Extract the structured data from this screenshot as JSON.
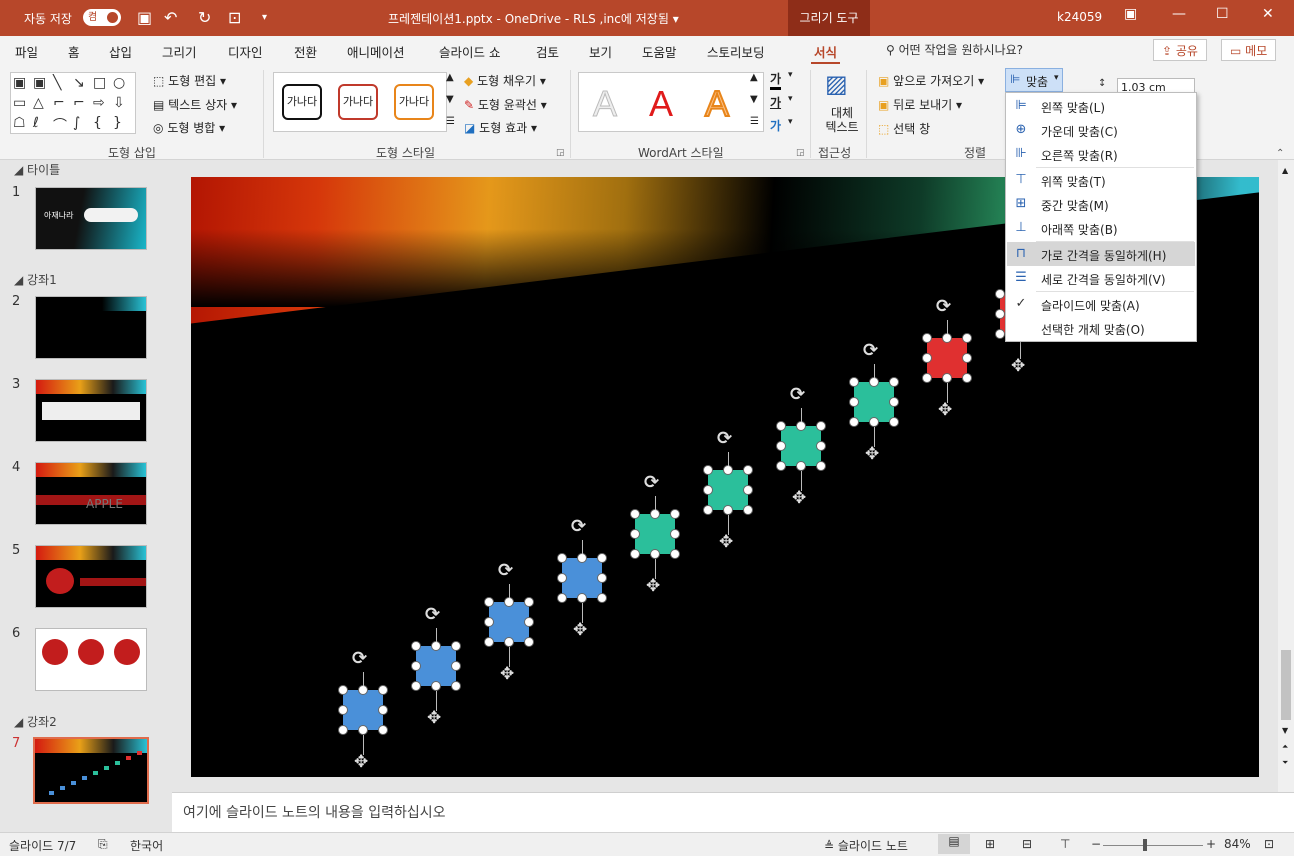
{
  "titlebar": {
    "autosave": "자동 저장",
    "toggle": "켬",
    "doc_title": "프레젠테이션1.pptx - OneDrive - RLS ,inc에 저장됨",
    "doc_caret": "▾",
    "context_tab": "그리기 도구",
    "user": "k24059",
    "ribbon_opts_icon": "▣",
    "minimize": "—",
    "maximize": "☐",
    "close": "✕"
  },
  "menu": {
    "tabs": [
      "파일",
      "홈",
      "삽입",
      "그리기",
      "디자인",
      "전환",
      "애니메이션",
      "슬라이드 쇼",
      "검토",
      "보기",
      "도움말",
      "스토리보딩",
      "서식"
    ],
    "tell_me": "어떤 작업을 원하시나요?",
    "share": "공유",
    "comments": "메모"
  },
  "ribbon": {
    "insert_shapes": {
      "label": "도형 삽입",
      "edit_shape": "도형 편집",
      "text_box": "텍스트 상자",
      "merge_shapes": "도형 병합"
    },
    "shape_styles": {
      "label": "도형 스타일",
      "sample": "가나다",
      "fill": "도형 채우기",
      "outline": "도형 윤곽선",
      "effects": "도형 효과"
    },
    "wordart": {
      "label": "WordArt 스타일",
      "letter": "A",
      "text_fill": "가",
      "text_outline": "가",
      "text_effects": "가"
    },
    "accessibility": {
      "label": "접근성",
      "alt_text": "대체 텍스트"
    },
    "arrange": {
      "label": "정렬",
      "bring_forward": "앞으로 가져오기",
      "send_backward": "뒤로 보내기",
      "selection_pane": "선택 창",
      "align": "맞춤"
    },
    "size": {
      "height": "1.03 cm"
    }
  },
  "align_menu": {
    "items": [
      {
        "icon": "⊫",
        "label": "왼쪽 맞춤(L)"
      },
      {
        "icon": "⊕",
        "label": "가운데 맞춤(C)"
      },
      {
        "icon": "⊪",
        "label": "오른쪽 맞춤(R)"
      },
      {
        "icon": "⊤",
        "label": "위쪽 맞춤(T)"
      },
      {
        "icon": "⊞",
        "label": "중간 맞춤(M)"
      },
      {
        "icon": "⊥",
        "label": "아래쪽 맞춤(B)"
      },
      {
        "icon": "⊓",
        "label": "가로 간격을 동일하게(H)",
        "highlighted": true
      },
      {
        "icon": "☰",
        "label": "세로 간격을 동일하게(V)"
      },
      {
        "icon": "✓",
        "label": "슬라이드에 맞춤(A)",
        "checked": true
      },
      {
        "icon": "",
        "label": "선택한 개체 맞춤(O)"
      }
    ]
  },
  "slides_pane": {
    "sections": [
      "타이틀",
      "강좌1",
      "강좌2"
    ],
    "numbers": [
      "1",
      "2",
      "3",
      "4",
      "5",
      "6",
      "7"
    ]
  },
  "thumb_text": {
    "s1": "아재나라",
    "s4": "APPLE"
  },
  "shapes": [
    {
      "color": "#4a90d9"
    },
    {
      "color": "#4a90d9"
    },
    {
      "color": "#4a90d9"
    },
    {
      "color": "#4a90d9"
    },
    {
      "color": "#2bbf9b"
    },
    {
      "color": "#2bbf9b"
    },
    {
      "color": "#2bbf9b"
    },
    {
      "color": "#2bbf9b"
    },
    {
      "color": "#e03030"
    },
    {
      "color": "#e03030"
    }
  ],
  "notes": {
    "placeholder": "여기에 슬라이드 노트의 내용을 입력하십시오"
  },
  "status": {
    "slide": "슬라이드 7/7",
    "language": "한국어",
    "notes": "슬라이드 노트",
    "zoom": "84%",
    "minus": "−",
    "plus": "+"
  }
}
